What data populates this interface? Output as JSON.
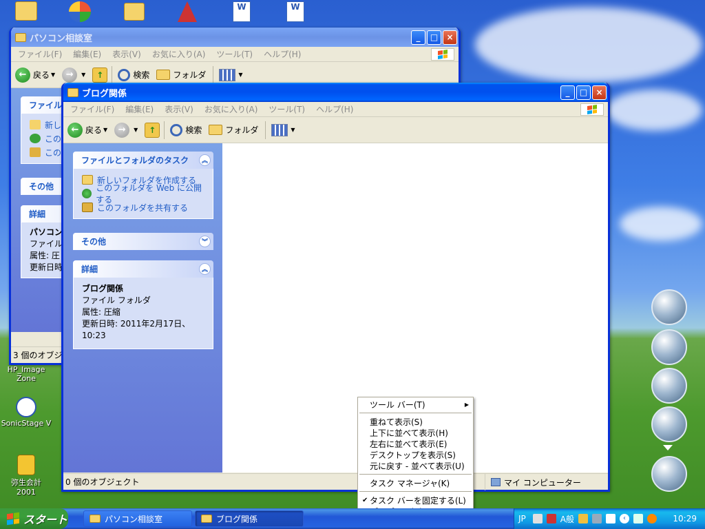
{
  "desktop": {
    "icons": [
      {
        "label": "HP_Image Zone"
      },
      {
        "label": "SonicStage V"
      },
      {
        "label": "弥生会計 2001"
      }
    ]
  },
  "back_window": {
    "title": "パソコン相談室",
    "menu": [
      "ファイル(F)",
      "編集(E)",
      "表示(V)",
      "お気に入り(A)",
      "ツール(T)",
      "ヘルプ(H)"
    ],
    "toolbar": {
      "back": "戻る",
      "search": "検索",
      "folders": "フォルダ"
    },
    "panel_tasks_partial": "ファイルと",
    "tasks_partial": [
      "新し",
      "このフ",
      "このフ"
    ],
    "other": "その他",
    "details_head": "詳細",
    "details_partial": [
      "パソコン",
      "ファイル",
      "属性: 圧",
      "更新日時"
    ],
    "status": "3 個のオブジェク"
  },
  "front_window": {
    "title": "ブログ関係",
    "menu": [
      "ファイル(F)",
      "編集(E)",
      "表示(V)",
      "お気に入り(A)",
      "ツール(T)",
      "ヘルプ(H)"
    ],
    "toolbar": {
      "back": "戻る",
      "search": "検索",
      "folders": "フォルダ"
    },
    "tasks_panel": {
      "title": "ファイルとフォルダのタスク",
      "items": [
        "新しいフォルダを作成する",
        "このフォルダを Web に公開する",
        "このフォルダを共有する"
      ]
    },
    "other_panel": {
      "title": "その他"
    },
    "details_panel": {
      "title": "詳細",
      "name": "ブログ関係",
      "type": "ファイル フォルダ",
      "attr": "属性: 圧縮",
      "modified": "更新日時: 2011年2月17日、10:23"
    },
    "status_left": "0 個のオブジェクト",
    "status_right": "マイ コンピューター"
  },
  "context_menu": {
    "items": [
      {
        "label": "ツール バー(T)",
        "submenu": true
      },
      {
        "label": "重ねて表示(S)"
      },
      {
        "label": "上下に並べて表示(H)"
      },
      {
        "label": "左右に並べて表示(E)"
      },
      {
        "label": "デスクトップを表示(S)"
      },
      {
        "label": "元に戻す - 並べて表示(U)"
      },
      {
        "label": "タスク マネージャ(K)"
      },
      {
        "label": "タスク バーを固定する(L)",
        "checked": true
      },
      {
        "label": "プロパティ(R)"
      }
    ]
  },
  "taskbar": {
    "start": "スタート",
    "buttons": [
      "パソコン相談室",
      "ブログ関係"
    ],
    "ime_lang": "JP",
    "ime_mode": "A般",
    "clock": "10:29"
  },
  "colors": {
    "title_active": "#0054e3",
    "panel_link": "#215dc6",
    "taskbar": "#245edb",
    "start_green": "#3a9e3a"
  }
}
